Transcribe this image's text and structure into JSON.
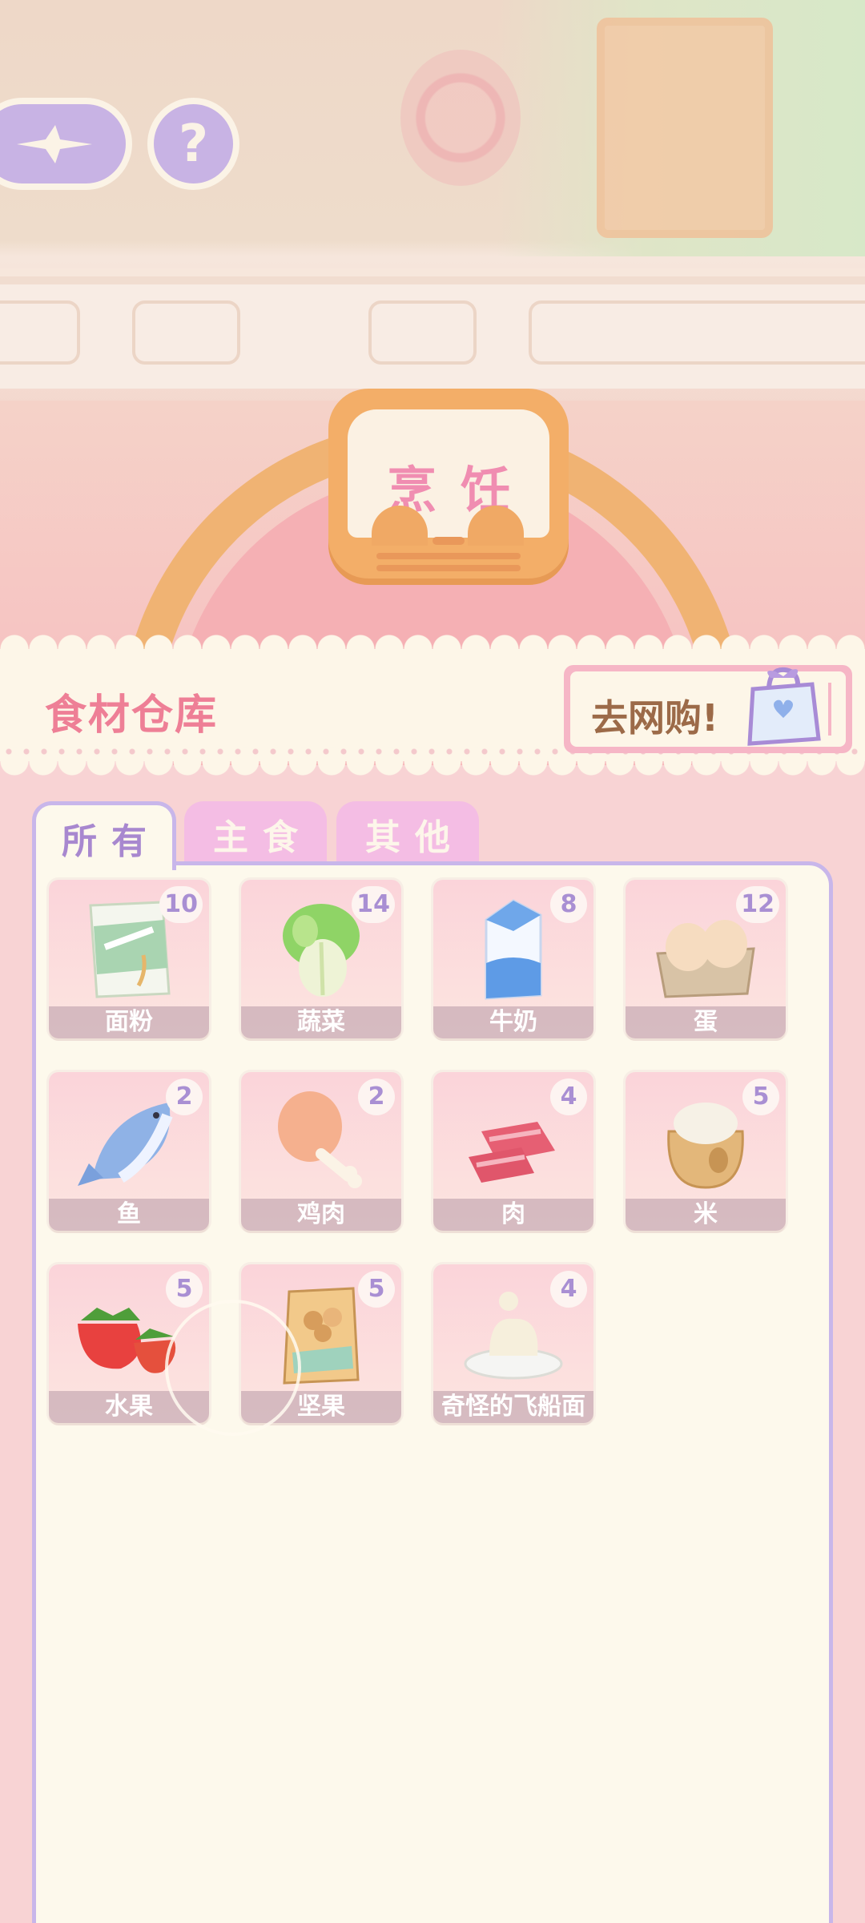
{
  "scene": {
    "sign_title": "烹饪"
  },
  "nav": {
    "back_icon": "sparkle-back-icon",
    "help_label": "?"
  },
  "header": {
    "title": "食材仓库",
    "shop_label": "去网购!",
    "shop_icon": "shopping-bag-icon"
  },
  "tabs": [
    {
      "label": "所有",
      "selected": true
    },
    {
      "label": "主食",
      "selected": false
    },
    {
      "label": "其他",
      "selected": false
    }
  ],
  "items": [
    {
      "name": "面粉",
      "count": "10",
      "icon": "flour-icon"
    },
    {
      "name": "蔬菜",
      "count": "14",
      "icon": "cabbage-icon"
    },
    {
      "name": "牛奶",
      "count": "8",
      "icon": "milk-icon"
    },
    {
      "name": "蛋",
      "count": "12",
      "icon": "egg-icon"
    },
    {
      "name": "鱼",
      "count": "2",
      "icon": "fish-icon"
    },
    {
      "name": "鸡肉",
      "count": "2",
      "icon": "drumstick-icon"
    },
    {
      "name": "肉",
      "count": "4",
      "icon": "meat-icon"
    },
    {
      "name": "米",
      "count": "5",
      "icon": "rice-sack-icon"
    },
    {
      "name": "水果",
      "count": "5",
      "icon": "strawberry-icon"
    },
    {
      "name": "坚果",
      "count": "5",
      "icon": "nuts-bag-icon"
    },
    {
      "name": "奇怪的飞船面",
      "count": "4",
      "icon": "noodle-plate-icon"
    }
  ],
  "colors": {
    "accent_purple": "#c8b6ea",
    "title_pink": "#ee7f96",
    "count_purple": "#a98fd3"
  }
}
